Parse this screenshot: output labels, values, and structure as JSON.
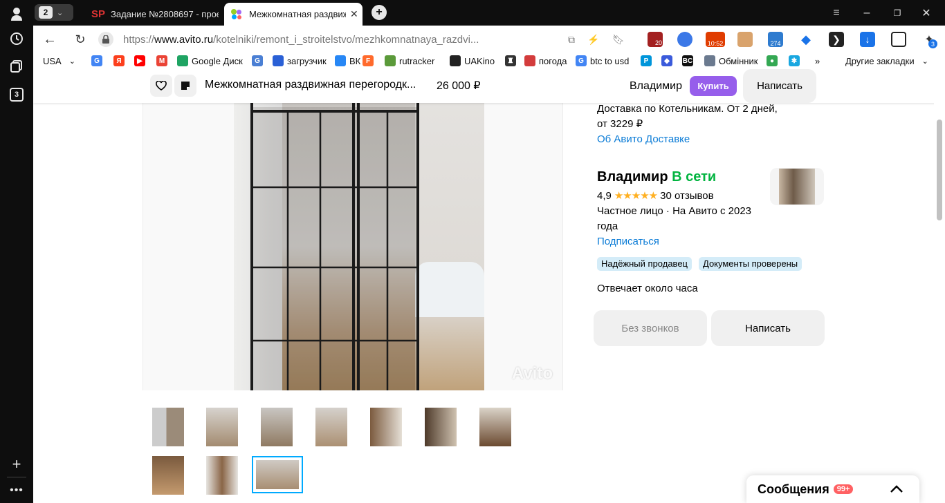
{
  "browser": {
    "tab_count": "2",
    "tabs": [
      {
        "favicon": "SP",
        "title": "Задание №2808697 - проект"
      },
      {
        "title": "Межкомнатная раздвиж"
      }
    ],
    "new_tab_icon": "plus-icon",
    "url": "https://www.avito.ru/kotelniki/remont_i_stroitelstvo/mezhkomnatnaya_razdvi...",
    "url_display": {
      "scheme": "https://",
      "host": "www.avito.ru",
      "path": "/kotelniki/remont_i_stroitelstvo/mezhkomnatnaya_razdvi..."
    },
    "extension_badges": {
      "calendar": "20",
      "counter": "274",
      "time": "10:52",
      "notifications": "3"
    },
    "side_badge": "3",
    "bookmarks": [
      {
        "label": "USA",
        "color": "#ffffff"
      },
      {
        "label": "",
        "color": "#4285f4",
        "glyph": "G"
      },
      {
        "label": "",
        "color": "#fc3f1d",
        "glyph": "Я"
      },
      {
        "label": "",
        "color": "#ff0000",
        "glyph": "▶"
      },
      {
        "label": "",
        "color": "#ea4335",
        "glyph": "M"
      },
      {
        "label": "Google Диск",
        "color": "#1fa463"
      },
      {
        "label": "",
        "color": "#4a7fd4",
        "glyph": "G"
      },
      {
        "label": "загрузчик",
        "color": "#2a60d6"
      },
      {
        "label": "ВК",
        "color": "#2787f5"
      },
      {
        "label": "",
        "color": "#ff6a2c",
        "glyph": "F"
      },
      {
        "label": "rutracker",
        "color": "#5b9a3a"
      },
      {
        "label": "UAKino",
        "color": "#222222"
      },
      {
        "label": "",
        "color": "#333333",
        "glyph": "♜"
      },
      {
        "label": "погода",
        "color": "#d33c3c"
      },
      {
        "label": "btc to usd",
        "color": "#4285f4",
        "glyph": "G"
      },
      {
        "label": "",
        "color": "#0095da",
        "glyph": "P"
      },
      {
        "label": "",
        "color": "#3b5bdb",
        "glyph": "◆"
      },
      {
        "label": "",
        "color": "#111111",
        "glyph": "BC"
      },
      {
        "label": "Обмінник",
        "color": "#6b7a8f"
      },
      {
        "label": "",
        "color": "#34a853",
        "glyph": "●"
      },
      {
        "label": "",
        "color": "#19a7e0",
        "glyph": "✱"
      }
    ],
    "more_bookmarks": "»",
    "other_bookmarks": "Другие закладки"
  },
  "sticky_header": {
    "title": "Межкомнатная раздвижная перегородк...",
    "price": "26 000 ₽",
    "seller_name": "Владимир",
    "buy_label": "Купить",
    "write_label": "Написать"
  },
  "delivery": {
    "text_line1": "Доставка по Котельникам. От 2 дней,",
    "text_line2": "от 3229 ₽",
    "link": "Об Авито Доставке"
  },
  "seller": {
    "name": "Владимир",
    "status": "В сети",
    "rating": "4,9",
    "stars": 5,
    "stars_text": "★★★★★",
    "reviews": "30 отзывов",
    "type_line1": "Частное лицо · На Авито с 2023",
    "type_line2": "года",
    "subscribe": "Подписаться",
    "badges": [
      "Надёжный продавец",
      "Документы проверены"
    ],
    "response_time": "Отвечает около часа",
    "no_calls_label": "Без звонков",
    "write_label": "Написать"
  },
  "gallery": {
    "watermark": "Avito",
    "selected_index": 9
  },
  "messages": {
    "label": "Сообщения",
    "badge": "99+"
  },
  "colors": {
    "avito_purple": "#965eeb",
    "link_blue": "#0a7bd6",
    "online_green": "#02b440",
    "badge_bg": "#d4ecf8",
    "messages_badge": "#ff6163",
    "selected_thumb_border": "#00aaff"
  }
}
